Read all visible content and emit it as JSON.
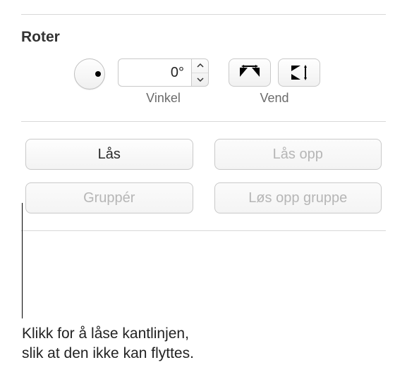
{
  "rotate": {
    "title": "Roter",
    "angle_value": "0°",
    "angle_label": "Vinkel",
    "flip_label": "Vend"
  },
  "buttons": {
    "lock": "Lås",
    "unlock": "Lås opp",
    "group": "Gruppér",
    "ungroup": "Løs opp gruppe"
  },
  "callout": {
    "line1": "Klikk for å låse kantlinjen,",
    "line2": "slik at den ikke kan flyttes."
  }
}
